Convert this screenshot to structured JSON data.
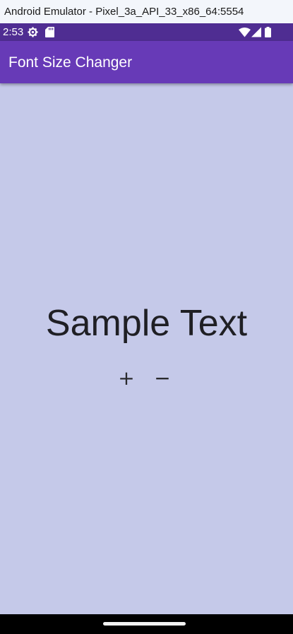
{
  "window": {
    "title": "Android Emulator - Pixel_3a_API_33_x86_64:5554"
  },
  "status_bar": {
    "time": "2:53",
    "left_icons": [
      "settings-gear-icon",
      "sd-card-icon"
    ],
    "right_icons": [
      "wifi-icon",
      "cell-signal-icon",
      "battery-icon"
    ],
    "background": "#4f2d92"
  },
  "app_bar": {
    "title": "Font Size Changer",
    "background": "#673ab7"
  },
  "main": {
    "sample_text": "Sample Text",
    "increase_label": "+",
    "decrease_label": "−",
    "background": "#c5c9e9"
  }
}
